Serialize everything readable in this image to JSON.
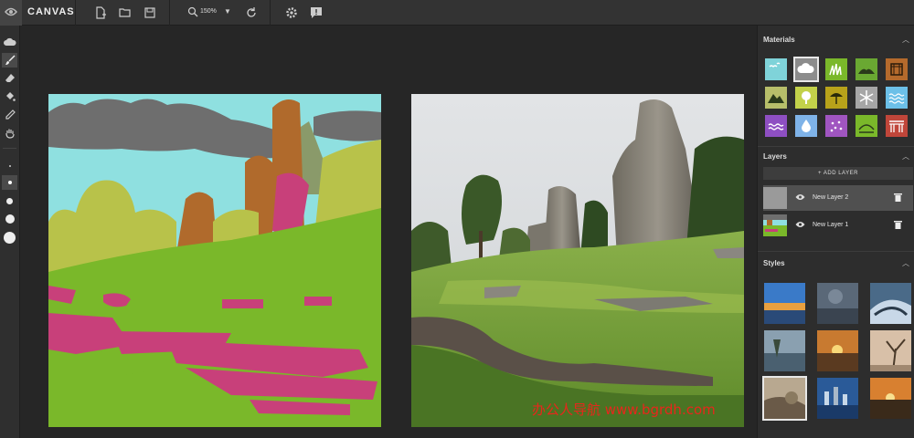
{
  "app": {
    "title": "CANVAS",
    "logo_icon": "nvidia-logo-icon"
  },
  "toolbar": {
    "zoom_label": "150%",
    "icons": [
      "new-file-icon",
      "open-folder-icon",
      "save-icon",
      "zoom-icon",
      "reset-icon",
      "settings-icon",
      "feedback-icon"
    ]
  },
  "tools": [
    "cloud-shape-icon",
    "brush-icon",
    "eraser-icon",
    "fill-bucket-icon",
    "eyedropper-icon",
    "pan-hand-icon"
  ],
  "brush_sizes": [
    "tiny",
    "small",
    "medium",
    "large",
    "xlarge"
  ],
  "materials": {
    "title": "Materials",
    "items": [
      {
        "name": "sky-birds",
        "color": "#7fd3d9"
      },
      {
        "name": "cloud",
        "color": "#8c8c8c",
        "selected": true
      },
      {
        "name": "grass",
        "color": "#7ab82a"
      },
      {
        "name": "hill",
        "color": "#6aa832"
      },
      {
        "name": "building",
        "color": "#b56a2c"
      },
      {
        "name": "mountain",
        "color": "#b7be6a"
      },
      {
        "name": "tree",
        "color": "#c3d14a"
      },
      {
        "name": "beach-umbrella",
        "color": "#b8a21a"
      },
      {
        "name": "snow",
        "color": "#a6a6a6"
      },
      {
        "name": "water-waves",
        "color": "#6cc0e8"
      },
      {
        "name": "sea",
        "color": "#8e4fc2"
      },
      {
        "name": "water-drop",
        "color": "#7fb3e8"
      },
      {
        "name": "flowers",
        "color": "#a055c0"
      },
      {
        "name": "river",
        "color": "#7ab82a"
      },
      {
        "name": "bridge",
        "color": "#c0463a"
      }
    ]
  },
  "layers": {
    "title": "Layers",
    "add_label": "+ ADD LAYER",
    "items": [
      {
        "name": "New Layer 2",
        "selected": true
      },
      {
        "name": "New Layer 1",
        "selected": false
      }
    ]
  },
  "styles": {
    "title": "Styles",
    "count": 9
  },
  "watermark": "办公人导航 www.bgrdh.com"
}
